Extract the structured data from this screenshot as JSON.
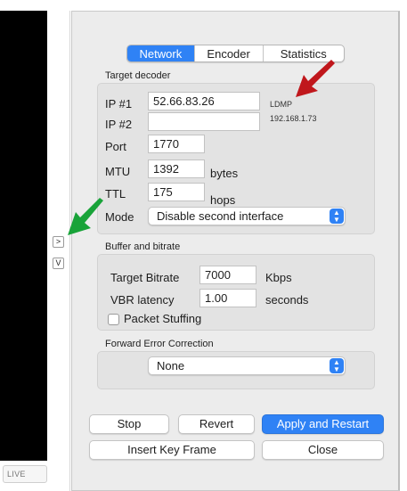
{
  "sidebar": {
    "live_label": "LIVE",
    "expand_label": ">",
    "collapse_label": "V"
  },
  "tabs": [
    {
      "label": "Network",
      "active": true
    },
    {
      "label": "Encoder",
      "active": false
    },
    {
      "label": "Statistics",
      "active": false
    }
  ],
  "target_decoder": {
    "group_label": "Target decoder",
    "ip1_label": "IP #1",
    "ip1_value": "52.66.83.26",
    "ip1_note": "LDMP",
    "ip2_label": "IP #2",
    "ip2_value": "",
    "ip2_note": "192.168.1.73",
    "port_label": "Port",
    "port_value": "1770",
    "mtu_label": "MTU",
    "mtu_value": "1392",
    "mtu_unit": "bytes",
    "ttl_label": "TTL",
    "ttl_value": "175",
    "ttl_unit": "hops",
    "mode_label": "Mode",
    "mode_value": "Disable second interface"
  },
  "buffer_bitrate": {
    "group_label": "Buffer and bitrate",
    "target_bitrate_label": "Target Bitrate",
    "target_bitrate_value": "7000",
    "target_bitrate_unit": "Kbps",
    "vbr_latency_label": "VBR latency",
    "vbr_latency_value": "1.00",
    "vbr_latency_unit": "seconds",
    "packet_stuffing_label": "Packet Stuffing",
    "packet_stuffing_checked": false
  },
  "fec": {
    "group_label": "Forward Error Correction",
    "value": "None"
  },
  "buttons": {
    "stop": "Stop",
    "revert": "Revert",
    "apply_restart": "Apply and Restart",
    "insert_key_frame": "Insert Key Frame",
    "close": "Close"
  },
  "colors": {
    "accent": "#2f82f5",
    "annotation_red": "#c0171c",
    "annotation_green": "#19a339"
  }
}
